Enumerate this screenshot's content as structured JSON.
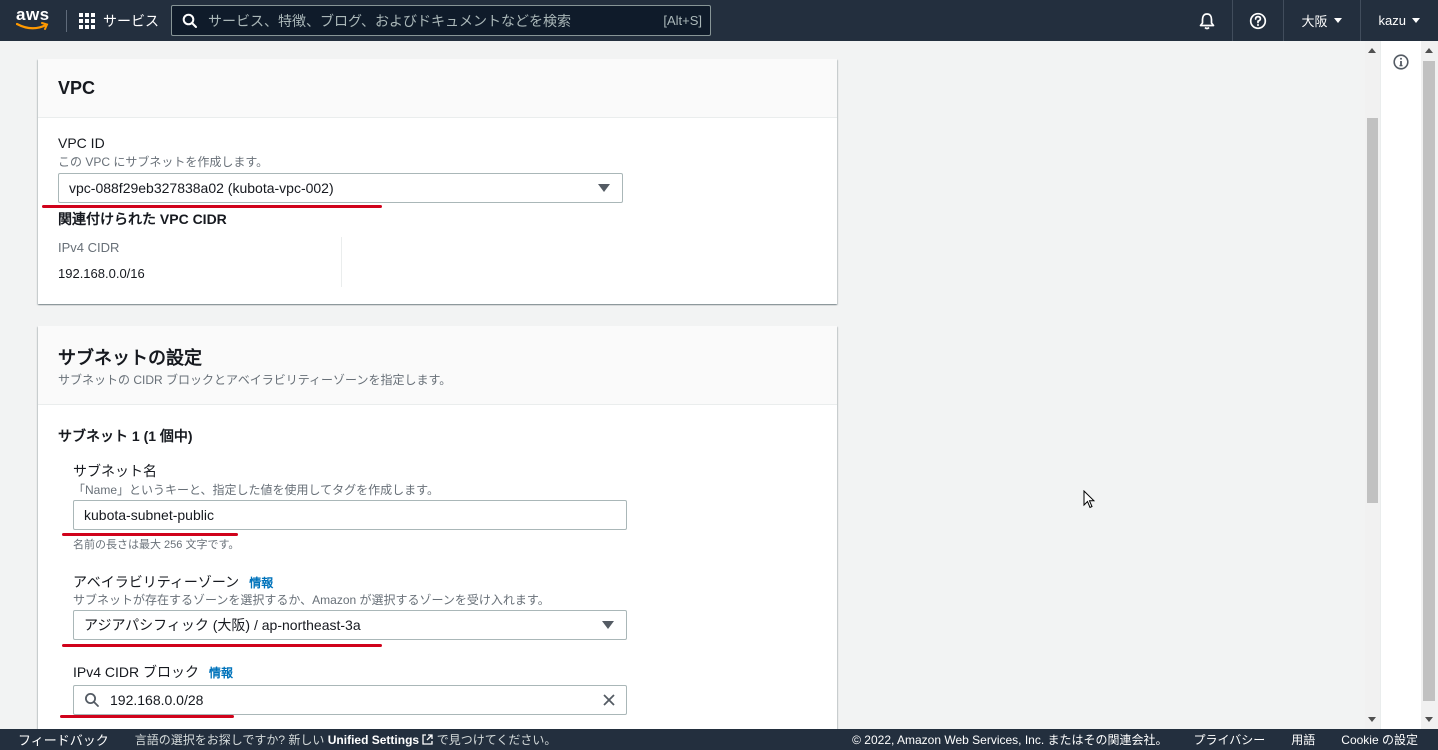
{
  "nav": {
    "logo": "aws",
    "services_label": "サービス",
    "search_placeholder": "サービス、特徴、ブログ、およびドキュメントなどを検索",
    "search_shortcut": "[Alt+S]",
    "region": "大阪",
    "user": "kazu"
  },
  "vpc_panel": {
    "title": "VPC",
    "vpc_id_label": "VPC ID",
    "vpc_id_desc": "この VPC にサブネットを作成します。",
    "vpc_id_value": "vpc-088f29eb327838a02 (kubota-vpc-002)",
    "cidr_heading": "関連付けられた VPC CIDR",
    "ipv4_cidr_label": "IPv4 CIDR",
    "ipv4_cidr_value": "192.168.0.0/16"
  },
  "subnet_panel": {
    "title": "サブネットの設定",
    "desc": "サブネットの CIDR ブロックとアベイラビリティーゾーンを指定します。",
    "subnet_heading": "サブネット 1 (1 個中)",
    "name_label": "サブネット名",
    "name_desc": "「Name」というキーと、指定した値を使用してタグを作成します。",
    "name_value": "kubota-subnet-public",
    "name_hint": "名前の長さは最大 256 文字です。",
    "az_label": "アベイラビリティーゾーン",
    "az_info": "情報",
    "az_desc": "サブネットが存在するゾーンを選択するか、Amazon が選択するゾーンを受け入れます。",
    "az_value": "アジアパシフィック (大阪) / ap-northeast-3a",
    "cidr_label": "IPv4 CIDR ブロック",
    "cidr_info": "情報",
    "cidr_value": "192.168.0.0/28"
  },
  "footer": {
    "feedback": "フィードバック",
    "lang_prefix": "言語の選択をお探しですか? 新しい",
    "lang_link": "Unified Settings",
    "lang_suffix": "で見つけてください。",
    "copyright": "© 2022, Amazon Web Services, Inc. またはその関連会社。",
    "privacy": "プライバシー",
    "terms": "用語",
    "cookie": "Cookie の設定"
  }
}
